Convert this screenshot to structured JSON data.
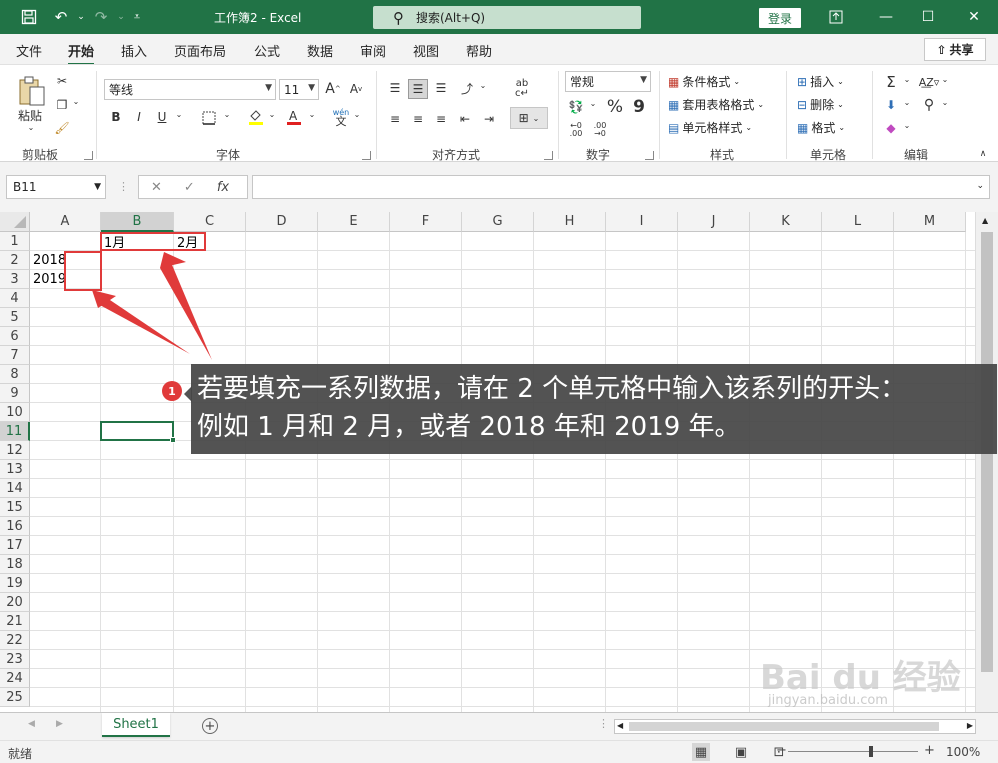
{
  "window": {
    "title": "工作簿2 - Excel",
    "search_placeholder": "搜索(Alt+Q)",
    "login_label": "登录",
    "share_label": "共享"
  },
  "tabs": [
    "文件",
    "开始",
    "插入",
    "页面布局",
    "公式",
    "数据",
    "审阅",
    "视图",
    "帮助"
  ],
  "active_tab": "开始",
  "ribbon": {
    "clipboard": {
      "paste_label": "粘贴",
      "group": "剪贴板"
    },
    "font": {
      "font_name": "等线",
      "font_size": "11",
      "group": "字体",
      "phonetic": "wén"
    },
    "alignment": {
      "group": "对齐方式"
    },
    "number": {
      "format": "常规",
      "group": "数字",
      "percent": "%",
      "comma": "9"
    },
    "styles": {
      "conditional": "条件格式",
      "table": "套用表格格式",
      "cell_styles": "单元格样式",
      "group": "样式"
    },
    "cells": {
      "insert": "插入",
      "delete": "删除",
      "format": "格式",
      "group": "单元格"
    },
    "editing": {
      "group": "编辑"
    }
  },
  "formula_bar": {
    "name_box": "B11",
    "fx": "fx",
    "value": ""
  },
  "columns": [
    "A",
    "B",
    "C",
    "D",
    "E",
    "F",
    "G",
    "H",
    "I",
    "J",
    "K",
    "L",
    "M"
  ],
  "rows": [
    "1",
    "2",
    "3",
    "4",
    "5",
    "6",
    "7",
    "8",
    "9",
    "10",
    "11",
    "12",
    "13",
    "14",
    "15",
    "16",
    "17",
    "18",
    "19",
    "20",
    "21",
    "22",
    "23",
    "24",
    "25"
  ],
  "selected_cell": {
    "col": "B",
    "row": "11"
  },
  "cells": {
    "B1": "1月",
    "C1": "2月",
    "A2": "2018",
    "A3": "2019"
  },
  "callout": {
    "number": "1",
    "line1": "若要填充一系列数据，请在 2 个单元格中输入该系列的开头：",
    "line2": "例如 1 月和 2 月，或者 2018 年和 2019 年。"
  },
  "sheet_tab": "Sheet1",
  "status": {
    "ready": "就绪",
    "zoom": "100%"
  },
  "watermark": {
    "brand": "Bai du 经验",
    "url": "jingyan.baidu.com"
  }
}
